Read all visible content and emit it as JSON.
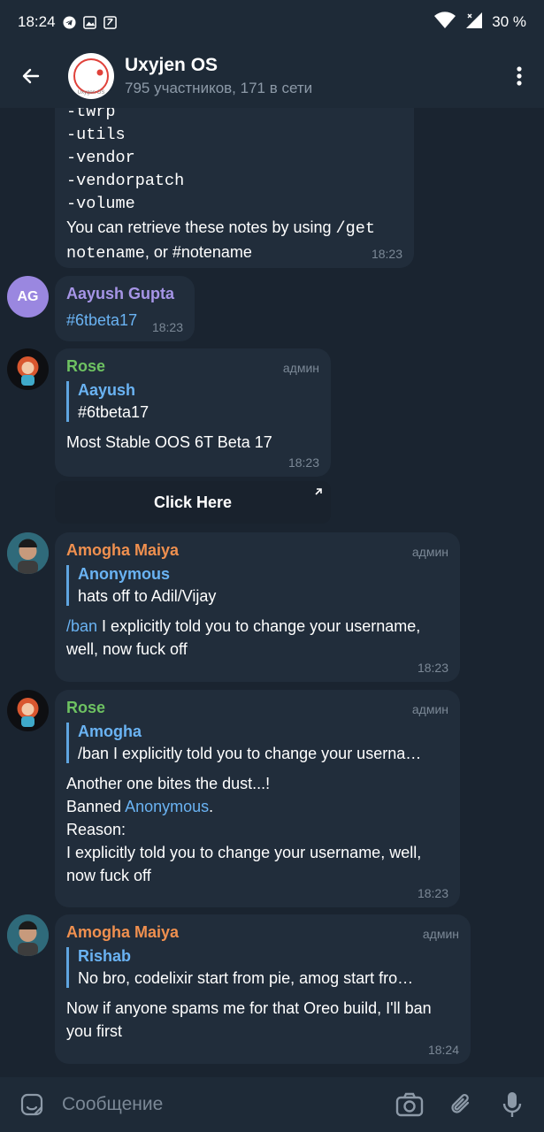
{
  "status_bar": {
    "time": "18:24",
    "battery": "30 %"
  },
  "header": {
    "title": "Uxyjen OS",
    "subtitle": "795 участников, 171 в сети",
    "avatar_caption": "Uxygen OS"
  },
  "messages": [
    {
      "id": "notes",
      "lines": [
        "-twrp",
        "-utils",
        "-vendor",
        "-vendorpatch",
        "-volume"
      ],
      "text_before_cmd": "You can retrieve these notes by using ",
      "cmd": "/get",
      "text_after_cmd_1": "notename",
      "text_after_cmd_2": ", or #notename",
      "time": "18:23"
    },
    {
      "id": "aayush",
      "avatar_initials": "AG",
      "sender": "Aayush Gupta",
      "text": "#6tbeta17",
      "time": "18:23"
    },
    {
      "id": "rose1",
      "sender": "Rose",
      "role": "админ",
      "reply_name": "Aayush",
      "reply_text": "#6tbeta17",
      "text": "Most Stable OOS 6T Beta 17",
      "time": "18:23",
      "button": "Click Here"
    },
    {
      "id": "amogha1",
      "sender": "Amogha Maiya",
      "role": "админ",
      "reply_name": "Anonymous",
      "reply_text": "hats off to Adil/Vijay",
      "cmd": "/ban",
      "text_1": " I explicitly told you to change your username,",
      "text_2": "well, now fuck off",
      "time": "18:23"
    },
    {
      "id": "rose2",
      "sender": "Rose",
      "role": "админ",
      "reply_name": "Amogha",
      "reply_text": "/ban I explicitly told you to change your userna…",
      "line1": "Another one bites the dust...!",
      "banned_prefix": "Banned ",
      "banned_user": "Anonymous",
      "banned_suffix": ".",
      "reason_label": "Reason:",
      "reason_1": "I explicitly told you to change your username, well,",
      "reason_2": "now fuck off",
      "time": "18:23"
    },
    {
      "id": "amogha2",
      "sender": "Amogha Maiya",
      "role": "админ",
      "reply_name": "Rishab",
      "reply_text": "No bro, codelixir start from pie, amog start fro…",
      "text_1": "Now if anyone spams me for that Oreo build, I'll ban",
      "text_2": "you first",
      "time": "18:24"
    }
  ],
  "input": {
    "placeholder": "Сообщение"
  },
  "colors": {
    "background": "#1a2430",
    "bubble": "#212d3b",
    "bar": "#1e2a37",
    "link": "#6ab3f3",
    "rose": "#6ec262",
    "amogha": "#f0904f",
    "aayush": "#a695e7"
  },
  "icons": [
    "back-arrow-icon",
    "more-vert-icon",
    "sticker-icon",
    "camera-icon",
    "attach-icon",
    "mic-icon",
    "wifi-icon",
    "signal-icon",
    "telegram-icon",
    "open-link-icon"
  ]
}
